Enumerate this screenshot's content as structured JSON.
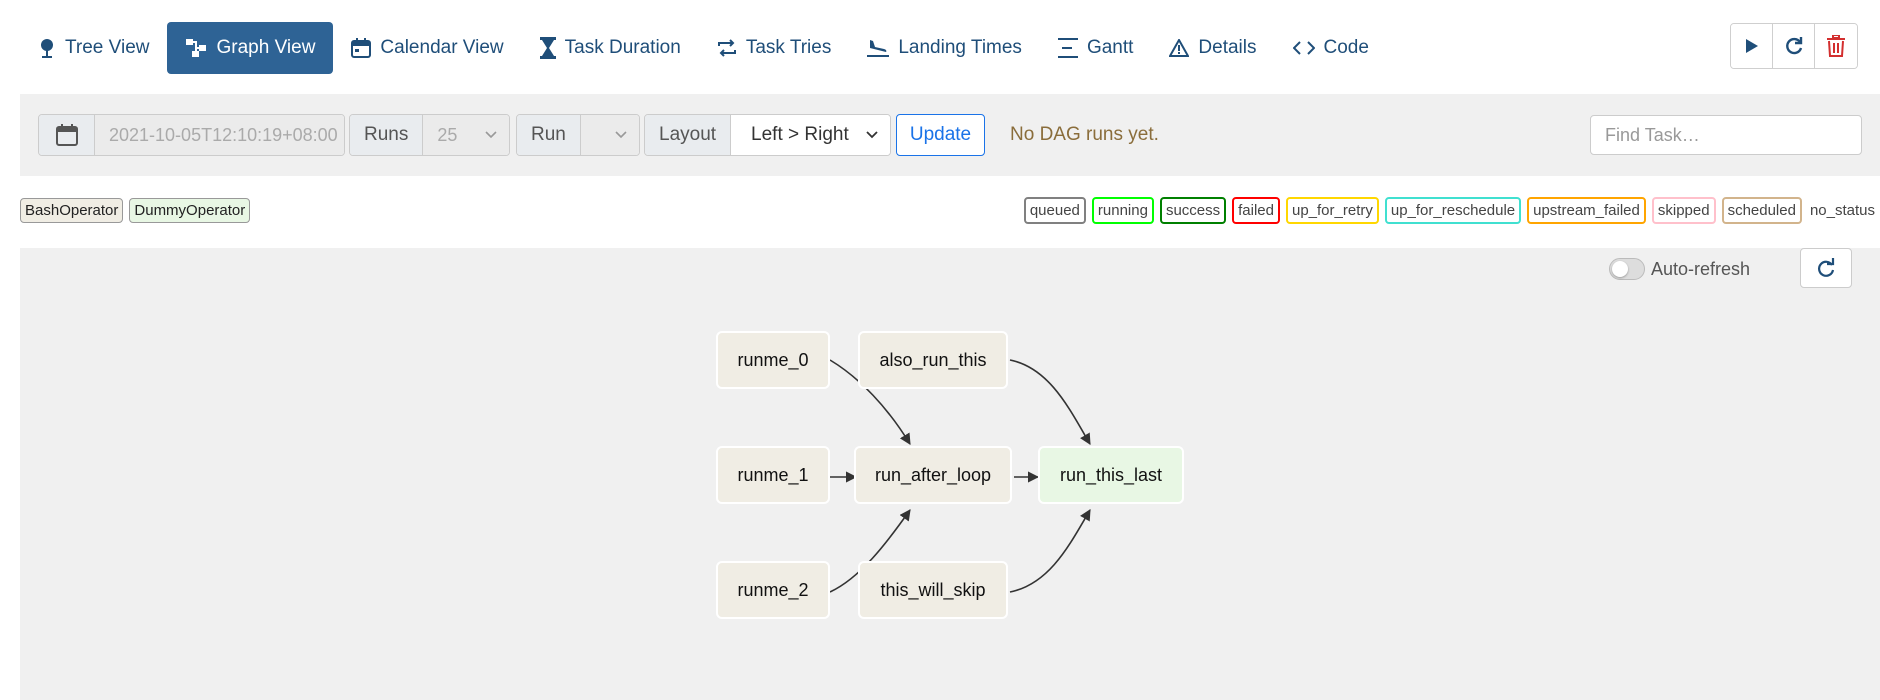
{
  "nav": {
    "tabs": [
      {
        "label": "Tree View",
        "icon": "tree-icon"
      },
      {
        "label": "Graph View",
        "icon": "graph-icon",
        "active": true
      },
      {
        "label": "Calendar View",
        "icon": "calendar-icon"
      },
      {
        "label": "Task Duration",
        "icon": "hourglass-icon"
      },
      {
        "label": "Task Tries",
        "icon": "retry-icon"
      },
      {
        "label": "Landing Times",
        "icon": "plane-landing-icon"
      },
      {
        "label": "Gantt",
        "icon": "gantt-icon"
      },
      {
        "label": "Details",
        "icon": "warning-triangle-icon"
      },
      {
        "label": "Code",
        "icon": "code-icon"
      }
    ],
    "actions": [
      "play-icon",
      "refresh-icon",
      "trash-icon"
    ]
  },
  "filter": {
    "base_date": "2021-10-05T12:10:19+08:00",
    "runs_label": "Runs",
    "runs_value": "25",
    "run_label": "Run",
    "run_value": "",
    "layout_label": "Layout",
    "layout_value": "Left > Right",
    "update_label": "Update",
    "no_runs_text": "No DAG runs yet.",
    "find_placeholder": "Find Task…"
  },
  "legend": {
    "operators": [
      {
        "label": "BashOperator",
        "color": "#f0ede4"
      },
      {
        "label": "DummyOperator",
        "color": "#e8f7e4"
      }
    ],
    "states": [
      {
        "label": "queued",
        "color": "#808080"
      },
      {
        "label": "running",
        "color": "#00ff00"
      },
      {
        "label": "success",
        "color": "#008000"
      },
      {
        "label": "failed",
        "color": "#ff0000"
      },
      {
        "label": "up_for_retry",
        "color": "#ffd700"
      },
      {
        "label": "up_for_reschedule",
        "color": "#40e0d0"
      },
      {
        "label": "upstream_failed",
        "color": "#ffa500"
      },
      {
        "label": "skipped",
        "color": "#ffc0cb"
      },
      {
        "label": "scheduled",
        "color": "#d2b48c"
      },
      {
        "label": "no_status",
        "color": ""
      }
    ]
  },
  "graph": {
    "autorefresh_label": "Auto-refresh",
    "nodes": [
      {
        "id": "runme_0",
        "label": "runme_0",
        "type": "BashOperator"
      },
      {
        "id": "runme_1",
        "label": "runme_1",
        "type": "BashOperator"
      },
      {
        "id": "runme_2",
        "label": "runme_2",
        "type": "BashOperator"
      },
      {
        "id": "also_run_this",
        "label": "also_run_this",
        "type": "BashOperator"
      },
      {
        "id": "run_after_loop",
        "label": "run_after_loop",
        "type": "BashOperator"
      },
      {
        "id": "this_will_skip",
        "label": "this_will_skip",
        "type": "BashOperator"
      },
      {
        "id": "run_this_last",
        "label": "run_this_last",
        "type": "DummyOperator"
      }
    ],
    "edges": [
      [
        "runme_0",
        "run_after_loop"
      ],
      [
        "runme_1",
        "run_after_loop"
      ],
      [
        "runme_2",
        "run_after_loop"
      ],
      [
        "also_run_this",
        "run_this_last"
      ],
      [
        "run_after_loop",
        "run_this_last"
      ],
      [
        "this_will_skip",
        "run_this_last"
      ]
    ]
  }
}
